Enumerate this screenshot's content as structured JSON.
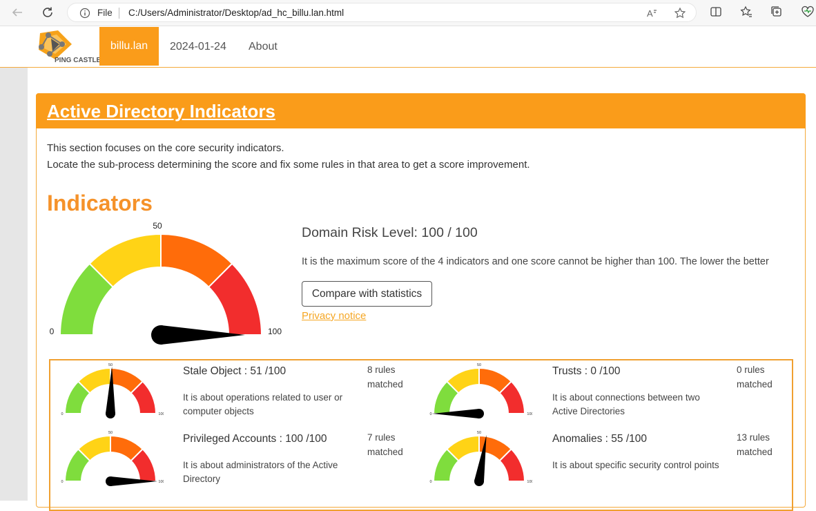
{
  "browser": {
    "file_label": "File",
    "url": "C:/Users/Administrator/Desktop/ad_hc_billu.lan.html"
  },
  "nav": {
    "logo_text": "PING CASTLE",
    "items": [
      {
        "label": "billu.lan",
        "active": true
      },
      {
        "label": "2024-01-24",
        "active": false
      },
      {
        "label": "About",
        "active": false
      }
    ]
  },
  "section": {
    "title": "Active Directory Indicators",
    "line1": "This section focuses on the core security indicators.",
    "line2": "Locate the sub-process determining the score and fix some rules in that area to get a score improvement.",
    "indicators_heading": "Indicators"
  },
  "main_gauge": {
    "value": 100,
    "label_min": "0",
    "label_mid": "50",
    "label_max": "100"
  },
  "risk": {
    "title": "Domain Risk Level: 100 / 100",
    "description": "It is the maximum score of the 4 indicators and one score cannot be higher than 100. The lower the better",
    "compare_label": "Compare with statistics",
    "privacy_label": "Privacy notice"
  },
  "colors": {
    "green": "#7fdd3d",
    "yellow": "#ffd316",
    "orange": "#ff6c0a",
    "red": "#f22d2d",
    "accent": "#fa9c1a"
  },
  "indicators": [
    {
      "title": "Stale Object : 51 /100",
      "score": 51,
      "desc": "It is about operations related to user or computer objects",
      "rules": "8 rules matched"
    },
    {
      "title": "Trusts : 0 /100",
      "score": 0,
      "desc": "It is about connections between two Active Directories",
      "rules": "0 rules matched"
    },
    {
      "title": "Privileged Accounts : 100 /100",
      "score": 100,
      "desc": "It is about administrators of the Active Directory",
      "rules": "7 rules matched"
    },
    {
      "title": "Anomalies : 55 /100",
      "score": 55,
      "desc": "It is about specific security control points",
      "rules": "13 rules matched"
    }
  ]
}
